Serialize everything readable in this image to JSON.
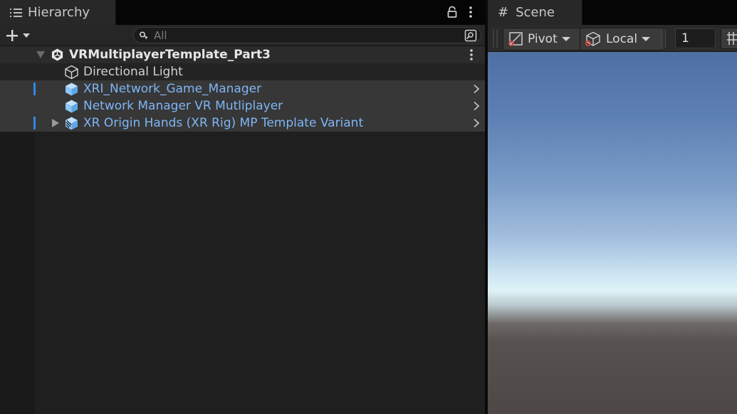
{
  "hierarchy": {
    "tab_label": "Hierarchy",
    "search": {
      "placeholder": "All"
    },
    "scene": {
      "name": "VRMultiplayerTemplate_Part3"
    },
    "items": [
      {
        "label": "Directional Light",
        "icon": "gameobject-cube-icon",
        "prefab": false
      },
      {
        "label": "XRI_Network_Game_Manager",
        "icon": "prefab-cube-icon",
        "prefab": true
      },
      {
        "label": "Network Manager VR Mutliplayer",
        "icon": "prefab-cube-icon",
        "prefab": true
      },
      {
        "label": "XR Origin Hands (XR Rig) MP Template Variant",
        "icon": "prefab-variant-icon",
        "prefab": true
      }
    ]
  },
  "scene_view": {
    "tab_label": "Scene",
    "pivot_label": "Pivot",
    "local_label": "Local",
    "snap_value": "1"
  },
  "colors": {
    "prefab_text": "#7fb6f5",
    "selection_marker": "#2f8ae5",
    "sky_top": "#4f6fa3",
    "ground": "#4d4846"
  }
}
